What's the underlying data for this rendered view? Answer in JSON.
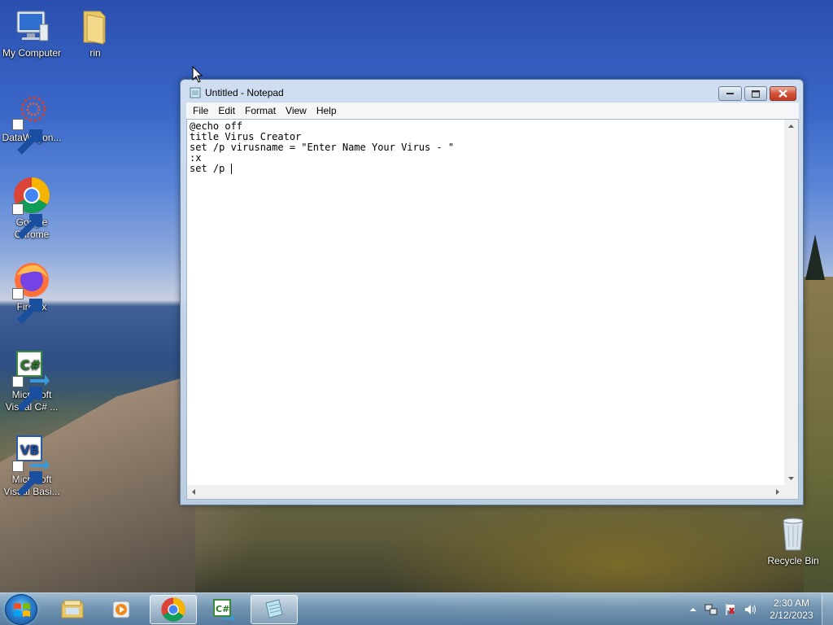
{
  "desktop": {
    "icons": [
      {
        "label": "My Computer",
        "icon": "computer-icon"
      },
      {
        "label": "rin",
        "icon": "folder-icon"
      },
      {
        "label": "DataWagon...",
        "icon": "datawagon-icon"
      },
      {
        "label": "Google Chrome",
        "icon": "chrome-icon"
      },
      {
        "label": "Firefox",
        "icon": "firefox-icon"
      },
      {
        "label": "Microsoft Visual C# ...",
        "icon": "visual-csharp-icon"
      },
      {
        "label": "Microsoft Visual Basi...",
        "icon": "visual-basic-icon"
      },
      {
        "label": "Recycle Bin",
        "icon": "recycle-bin-icon"
      }
    ]
  },
  "notepad": {
    "title": "Untitled - Notepad",
    "menu": [
      "File",
      "Edit",
      "Format",
      "View",
      "Help"
    ],
    "content": "@echo off\ntitle Virus Creator\nset /p virusname = \"Enter Name Your Virus - \"\n:x\nset /p "
  },
  "taskbar": {
    "pinned": [
      {
        "name": "explorer",
        "icon": "folder-library-icon"
      },
      {
        "name": "media-player",
        "icon": "media-player-icon"
      },
      {
        "name": "chrome",
        "icon": "chrome-icon"
      },
      {
        "name": "visual-csharp",
        "icon": "visual-csharp-icon"
      },
      {
        "name": "notepad",
        "icon": "notepad-icon"
      }
    ],
    "tray_icons": [
      "show-hidden-icons-arrow",
      "network-icon",
      "action-center-flag-icon",
      "volume-icon"
    ],
    "clock": {
      "time": "2:30 AM",
      "date": "2/12/2023"
    }
  },
  "colors": {
    "accent": "#3a68c8",
    "close_button": "#c2391f",
    "window_frame": "#bed2e8"
  }
}
